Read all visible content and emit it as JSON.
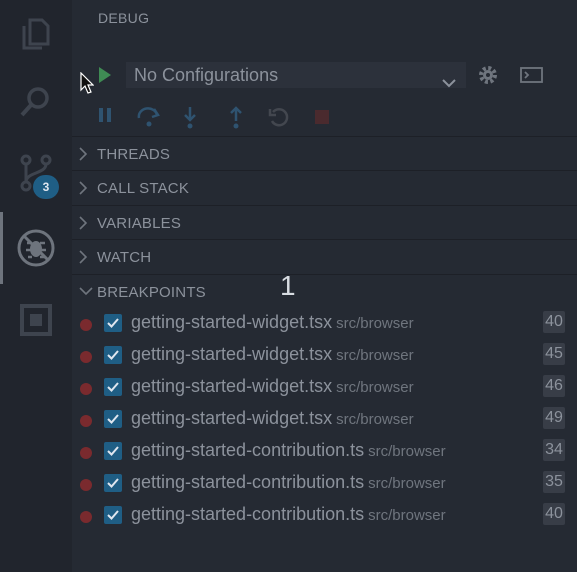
{
  "activity_bar": {
    "items": [
      {
        "name": "explorer",
        "icon": "files-icon"
      },
      {
        "name": "search",
        "icon": "search-icon"
      },
      {
        "name": "scm",
        "icon": "source-control-icon",
        "badge": "3"
      },
      {
        "name": "debug",
        "icon": "debug-icon",
        "active": true
      },
      {
        "name": "extensions",
        "icon": "extensions-icon"
      }
    ]
  },
  "debug": {
    "title": "DEBUG",
    "config_value": "No Configurations"
  },
  "controls": [
    "pause-icon",
    "step-over-icon",
    "step-into-icon",
    "step-out-icon",
    "restart-icon",
    "stop-icon"
  ],
  "sections": {
    "threads": "THREADS",
    "call_stack": "CALL STACK",
    "variables": "VARIABLES",
    "watch": "WATCH",
    "breakpoints": "BREAKPOINTS"
  },
  "breakpoints": [
    {
      "file": "getting-started-widget.tsx",
      "path": "src/browser",
      "line": "40"
    },
    {
      "file": "getting-started-widget.tsx",
      "path": "src/browser",
      "line": "45"
    },
    {
      "file": "getting-started-widget.tsx",
      "path": "src/browser",
      "line": "46"
    },
    {
      "file": "getting-started-widget.tsx",
      "path": "src/browser",
      "line": "49"
    },
    {
      "file": "getting-started-contribution.ts",
      "path": "src/browser",
      "line": "34"
    },
    {
      "file": "getting-started-contribution.ts",
      "path": "src/browser",
      "line": "35"
    },
    {
      "file": "getting-started-contribution.ts",
      "path": "src/browser",
      "line": "40"
    }
  ],
  "overlay_number": "1",
  "colors": {
    "accent": "#1f5e85",
    "breakpoint": "#7a2a2e",
    "play": "#3f8b54"
  }
}
